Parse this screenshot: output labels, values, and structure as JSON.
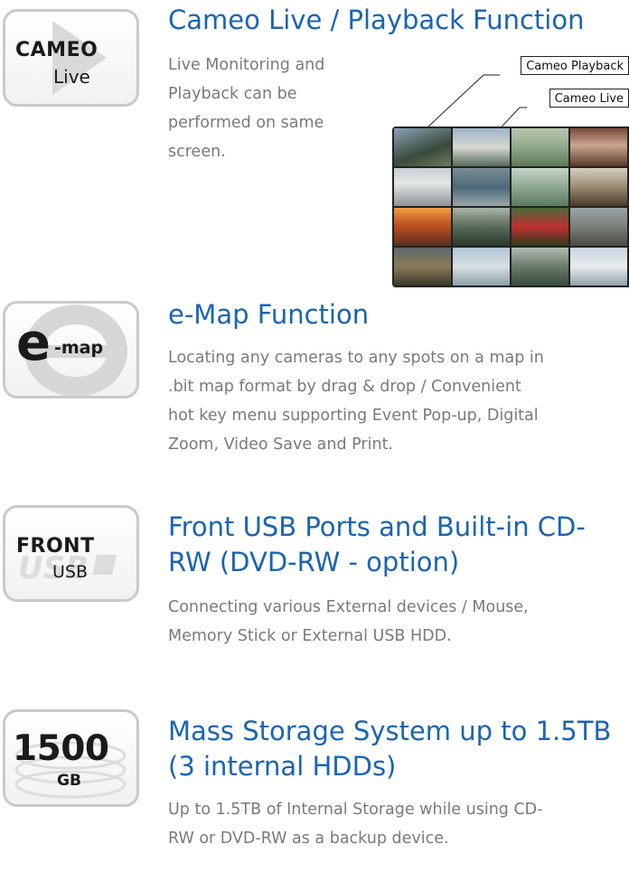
{
  "sections": [
    {
      "icon": {
        "name": "cameo-live-icon",
        "line1": "CAMEO",
        "line2": "Live"
      },
      "title": "Cameo Live / Playback Function",
      "body": [
        "Live Monitoring and",
        "Playback can be",
        "performed on same",
        "screen."
      ],
      "callouts": {
        "playback": "Cameo Playback",
        "live": "Cameo Live"
      }
    },
    {
      "icon": {
        "name": "e-map-icon",
        "line1": "e",
        "line2": "-map"
      },
      "title": "e-Map Function",
      "body": [
        "Locating any cameras to any spots on a map in",
        ".bit map format by drag & drop / Convenient",
        "hot key menu supporting Event Pop-up, Digital",
        "Zoom, Video Save and Print."
      ]
    },
    {
      "icon": {
        "name": "front-usb-icon",
        "line1": "FRONT",
        "line2": "USB"
      },
      "title": [
        "Front USB Ports and Built-in CD-",
        "RW (DVD-RW - option)"
      ],
      "body": [
        "Connecting various External devices / Mouse,",
        "Memory Stick or External USB HDD."
      ]
    },
    {
      "icon": {
        "name": "storage-1500gb-icon",
        "line1": "1500",
        "line2": "GB"
      },
      "title": [
        "Mass Storage System up to 1.5TB",
        "(3 internal HDDs)"
      ],
      "body": [
        "Up to 1.5TB of Internal Storage while using CD-",
        "RW or DVD-RW as a backup device."
      ]
    }
  ],
  "colors": {
    "title": "#1b64b2",
    "body": "#7a7a7a",
    "icon_border": "#c9c9c9"
  }
}
